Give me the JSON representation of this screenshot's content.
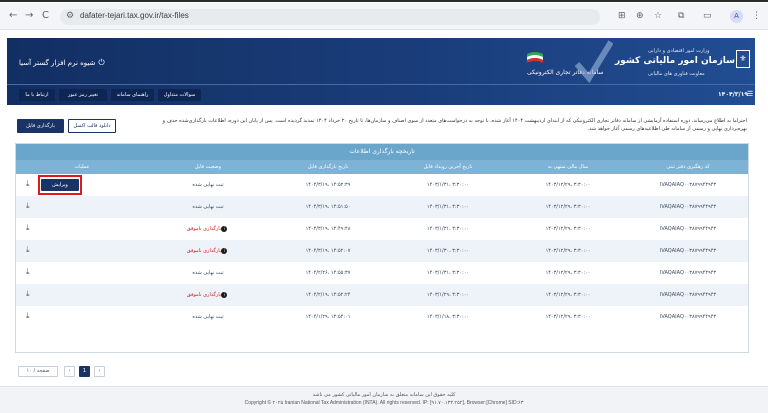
{
  "browser": {
    "url": "dafater-tejari.tax.gov.ir/tax-files",
    "back_icon": "←",
    "forward_icon": "→",
    "reload_icon": "C",
    "tune_icon": "⚙",
    "translate_icon": "⊞",
    "zoom_icon": "⊕",
    "star_icon": "☆",
    "extensions_icon": "⧉",
    "sidepanel_icon": "▭",
    "profile_initial": "A",
    "menu_icon": "⋮"
  },
  "header": {
    "login_label": "شیوه نرم افزار گستر آسیا",
    "lock_icon": "⏻",
    "ministry": "وزارت امور اقتصادی و دارایی",
    "organization": "سازمان امور مالیاتی کشور",
    "deputy": "معاونت فناوری های مالیاتی",
    "system_name": "سامانه دفاتر تجاری الکترونیکی",
    "menu": [
      "سوالات متداول",
      "راهنمای سامانه",
      "تغییر رمز عبور",
      "ارتباط با ما"
    ],
    "date": "۱۴۰۴/۳/۱۹",
    "menu_icon": "☰"
  },
  "notice": "احتراما به اطلاع می‌رساند، دوره استفاده آزمایشی از سامانه دفاتر تجاری الکترونیکی که از ابتدای اردیبهشت ۱۴۰۴ آغاز شده، با توجه به درخواست‌های متعدد از سوی اصناف و سازمان‌ها، تا تاریخ ۲۰ خرداد ۱۴۰۴ تمدید گردیده است. پس از پایان این دوره، اطلاعات بارگذاری‌شده حذف و بهره‌برداری نهایی و رسمی از سامانه طی اطلاعیه‌های رسمی آغاز خواهد شد.",
  "actions": {
    "upload_label": "بارگذاری فایل",
    "template_label": "دانلود قالب اکسل"
  },
  "table": {
    "title": "تاریخچه بارگذاری اطلاعات",
    "columns": [
      "کد رهگیری دفتر ثبتی",
      "سال مالی منتهی به",
      "تاریخ آخرین رویداد فایل",
      "تاریخ بارگذاری فایل",
      "وضعیت فایل",
      "عملیات"
    ],
    "edit_label": "ویرایش",
    "download_icon": "⤓",
    "info_icon": "i",
    "rows": [
      {
        "code": "IVAQAIAQ۰۰۳۸۷۹۹۴۴۹۴۳",
        "fiscal": "۱۴۰۳/۱۲/۲۹، ۳:۳۰:۰۰",
        "last_event": "۱۴۰۳/۱/۳۱، ۳:۳۰:۰۰",
        "uploaded": "۱۴۰۴/۳/۱۹، ۱۴:۵۲:۳۹",
        "status": "ثبت نهایی شده",
        "error": false,
        "edit": true
      },
      {
        "code": "IVAQAIAQ۰۰۳۸۷۹۹۴۴۹۴۳",
        "fiscal": "۱۴۰۳/۱۲/۲۹، ۳:۳۰:۰۰",
        "last_event": "۱۴۰۳/۱/۳۱، ۳:۳۰:۰۰",
        "uploaded": "۱۴۰۴/۳/۱۹، ۱۴:۵۱:۵۰",
        "status": "ثبت نهایی شده",
        "error": false,
        "edit": false
      },
      {
        "code": "IVAQAIAQ۰۰۳۸۷۹۹۴۴۹۴۳",
        "fiscal": "۱۴۰۳/۱۲/۲۹، ۳:۳۰:۰۰",
        "last_event": "۱۴۰۳/۱/۳۱، ۳:۳۰:۰۰",
        "uploaded": "۱۴۰۴/۳/۱۹، ۱۴:۴۹:۴۸",
        "status": "بارگذاری ناموفق",
        "error": true,
        "edit": false
      },
      {
        "code": "IVAQAIAQ۰۰۳۸۷۹۹۴۴۹۴۳",
        "fiscal": "۱۴۰۳/۱۲/۲۹، ۳:۳۰:۰۰",
        "last_event": "۱۴۰۳/۱/۳۰، ۳:۳۰:۰۰",
        "uploaded": "۱۴۰۴/۳/۱۹، ۱۴:۵۲:۰۷",
        "status": "بارگذاری ناموفق",
        "error": true,
        "edit": false
      },
      {
        "code": "IVAQAIAQ۰۰۳۸۷۹۹۴۴۹۴۳",
        "fiscal": "۱۴۰۳/۱۲/۲۹، ۳:۳۰:۰۰",
        "last_event": "۱۴۰۳/۱/۳۱، ۳:۳۰:۰۰",
        "uploaded": "۱۴۰۴/۲/۲۶، ۱۴:۵۵:۳۷",
        "status": "ثبت نهایی شده",
        "error": false,
        "edit": false
      },
      {
        "code": "IVAQAIAQ۰۰۳۸۷۹۹۴۴۹۴۳",
        "fiscal": "۱۴۰۳/۱۲/۲۹، ۳:۳۰:۰۰",
        "last_event": "۱۴۰۳/۱/۲۹، ۳:۳۰:۰۰",
        "uploaded": "۱۴۰۴/۲/۱۹، ۱۴:۵۲:۲۴",
        "status": "بارگذاری ناموفق",
        "error": true,
        "edit": false
      },
      {
        "code": "IVAQAIAQ۰۰۳۸۷۹۹۴۴۹۴۳",
        "fiscal": "۱۴۰۳/۱۲/۲۹، ۳:۳۰:۰۰",
        "last_event": "۱۴۰۳/۱/۱۸، ۳:۳۰:۰۰",
        "uploaded": "۱۴۰۴/۱/۲۹، ۱۴:۵۴:۰۱",
        "status": "ثبت نهایی شده",
        "error": false,
        "edit": false
      }
    ]
  },
  "pagination": {
    "page_size": "۱۰ / صفحه",
    "current_page": "1",
    "prev_icon": "‹",
    "next_icon": "›"
  },
  "footer": {
    "rights_fa": "کلیه حقوق این سامانه متعلق به سازمان امور مالیاتی کشور می باشد",
    "copyright_en": "Copyright © ۲۰۲۵ Iranian National Tax Administration (INTA). All rights reserved. IP: [۹۱.۷۰.۱۳۳.۲۵۲], Browser:[Chrome] SID:۶۳"
  },
  "colors": {
    "header_navy": "#1a3d7a",
    "button_navy": "#1a3366",
    "table_header": "#7fb3d6",
    "error_red": "#d11c1c",
    "highlight_red": "#e0191c"
  }
}
